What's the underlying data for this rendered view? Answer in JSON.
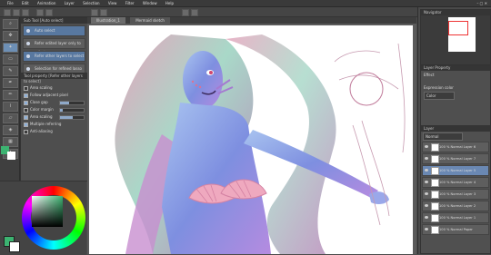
{
  "menu": [
    "File",
    "Edit",
    "Animation",
    "Layer",
    "Selection",
    "View",
    "Filter",
    "Window",
    "Help"
  ],
  "canvas_tabs": [
    "Illustration_1",
    "Mermaid sketch"
  ],
  "sub_tool": {
    "title": "Sub Tool [Auto select]",
    "items": [
      "Auto select",
      "Refer edited layer only to select",
      "Refer other layers to select",
      "Selection for refined lasso"
    ]
  },
  "tool_property": {
    "title": "Tool property [Refer other layers to select]",
    "items": [
      {
        "label": "Area scaling",
        "checked": false
      },
      {
        "label": "Follow adjacent pixel",
        "checked": true
      },
      {
        "label": "Close gap",
        "checked": true
      },
      {
        "label": "Color margin",
        "checked": false,
        "value": 10
      },
      {
        "label": "Area scaling",
        "checked": true
      },
      {
        "label": "Multiple referring",
        "checked": true
      },
      {
        "label": "Anti-aliasing",
        "checked": false
      }
    ]
  },
  "navigator": {
    "title": "Navigator"
  },
  "layer_property": {
    "title": "Layer Property",
    "effect_label": "Effect",
    "expression_label": "Expression color",
    "expression_value": "Color"
  },
  "layers": {
    "title": "Layer",
    "blend_mode": "Normal",
    "items": [
      {
        "name": "100 % Normal\nLayer 6",
        "selected": false
      },
      {
        "name": "100 % Normal\nLayer 7",
        "selected": false
      },
      {
        "name": "100 % Normal\nLayer 5",
        "selected": true
      },
      {
        "name": "100 % Normal\nLayer 4",
        "selected": false
      },
      {
        "name": "100 % Normal\nLayer 3",
        "selected": false
      },
      {
        "name": "100 % Normal\nLayer 2",
        "selected": false
      },
      {
        "name": "100 % Normal\nLayer 1",
        "selected": false
      },
      {
        "name": "100 % Normal\nPaper",
        "selected": false
      }
    ]
  },
  "colors": {
    "main": "#3cb371",
    "sub": "#ffffff",
    "accent": "#5878a0"
  }
}
